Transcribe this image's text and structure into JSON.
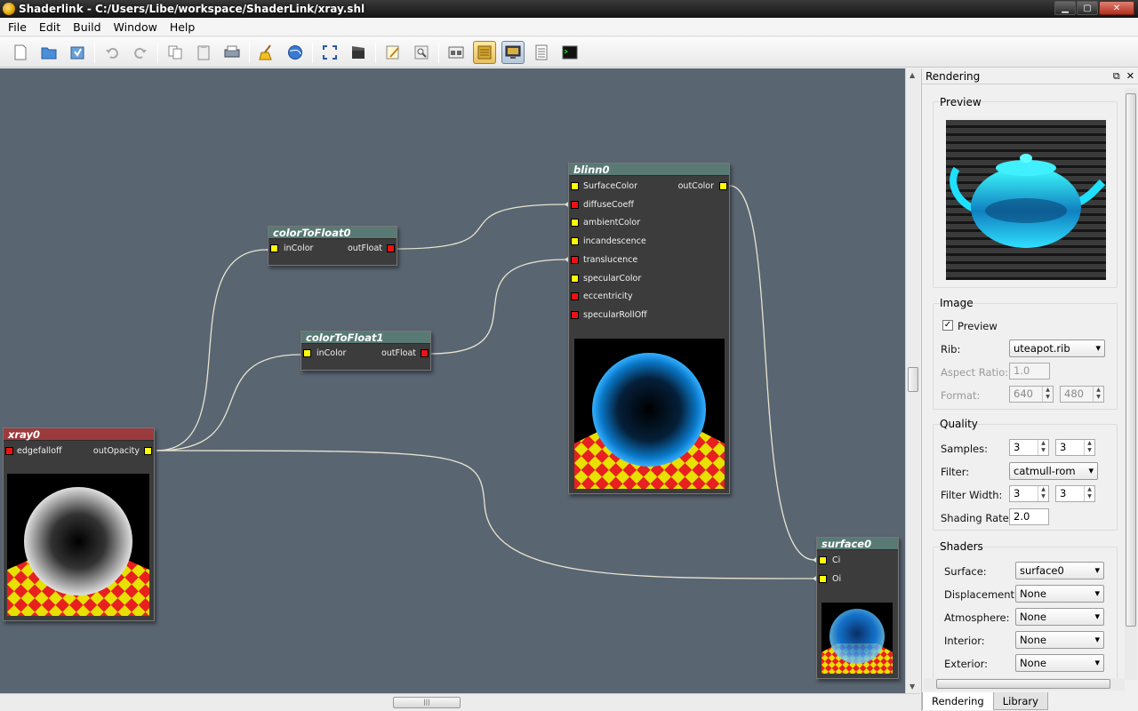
{
  "window": {
    "title": "Shaderlink - C:/Users/Libe/workspace/ShaderLink/xray.shl"
  },
  "menu": [
    "File",
    "Edit",
    "Build",
    "Window",
    "Help"
  ],
  "toolbar": [
    {
      "name": "new-icon"
    },
    {
      "name": "open-icon"
    },
    {
      "name": "save-icon"
    },
    {
      "sep": true
    },
    {
      "name": "undo-icon"
    },
    {
      "name": "redo-icon"
    },
    {
      "sep": true
    },
    {
      "name": "copy-icon"
    },
    {
      "name": "paste-icon"
    },
    {
      "name": "print-icon"
    },
    {
      "sep": true
    },
    {
      "name": "clean-icon"
    },
    {
      "name": "globe-icon"
    },
    {
      "sep": true
    },
    {
      "name": "fullscreen-icon"
    },
    {
      "name": "clapper-icon"
    },
    {
      "sep": true
    },
    {
      "name": "edit-icon"
    },
    {
      "name": "inspect-icon"
    },
    {
      "sep": true
    },
    {
      "name": "layout-icon"
    },
    {
      "name": "panel-icon",
      "state": "on"
    },
    {
      "name": "monitor-icon",
      "state": "on2"
    },
    {
      "name": "list-icon"
    },
    {
      "name": "console-icon"
    }
  ],
  "nodes": {
    "colorToFloat0": {
      "title": "colorToFloat0",
      "in": "inColor",
      "out": "outFloat"
    },
    "colorToFloat1": {
      "title": "colorToFloat1",
      "in": "inColor",
      "out": "outFloat"
    },
    "blinn0": {
      "title": "blinn0",
      "inputs": [
        "SurfaceColor",
        "diffuseCoeff",
        "ambientColor",
        "incandescence",
        "translucence",
        "specularColor",
        "eccentricity",
        "specularRollOff"
      ],
      "input_colors": [
        "#ffff00",
        "#ee1111",
        "#ffff00",
        "#ffff00",
        "#ee1111",
        "#ffff00",
        "#ee1111",
        "#ee1111"
      ],
      "out": "outColor"
    },
    "xray0": {
      "title": "xray0",
      "in": "edgefalloff",
      "out": "outOpacity"
    },
    "surface0": {
      "title": "surface0",
      "inputs": [
        "Ci",
        "Oi"
      ]
    }
  },
  "panel": {
    "title": "Rendering",
    "preview_label": "Preview",
    "image": {
      "label": "Image",
      "preview_checkbox": "Preview",
      "preview_checked": true,
      "rib_label": "Rib:",
      "rib_value": "uteapot.rib",
      "aspect_label": "Aspect Ratio:",
      "aspect_value": "1.0",
      "format_label": "Format:",
      "format_w": "640",
      "format_h": "480"
    },
    "quality": {
      "label": "Quality",
      "samples_label": "Samples:",
      "samples_x": "3",
      "samples_y": "3",
      "filter_label": "Filter:",
      "filter_value": "catmull-rom",
      "fwidth_label": "Filter Width:",
      "fwidth_x": "3",
      "fwidth_y": "3",
      "srate_label": "Shading Rate:",
      "srate_value": "2.0"
    },
    "shaders": {
      "label": "Shaders",
      "surface_label": "Surface:",
      "surface_value": "surface0",
      "displacement_label": "Displacement:",
      "displacement_value": "None",
      "atmosphere_label": "Atmosphere:",
      "atmosphere_value": "None",
      "interior_label": "Interior:",
      "interior_value": "None",
      "exterior_label": "Exterior:",
      "exterior_value": "None"
    },
    "tabs": [
      "Rendering",
      "Library"
    ]
  }
}
